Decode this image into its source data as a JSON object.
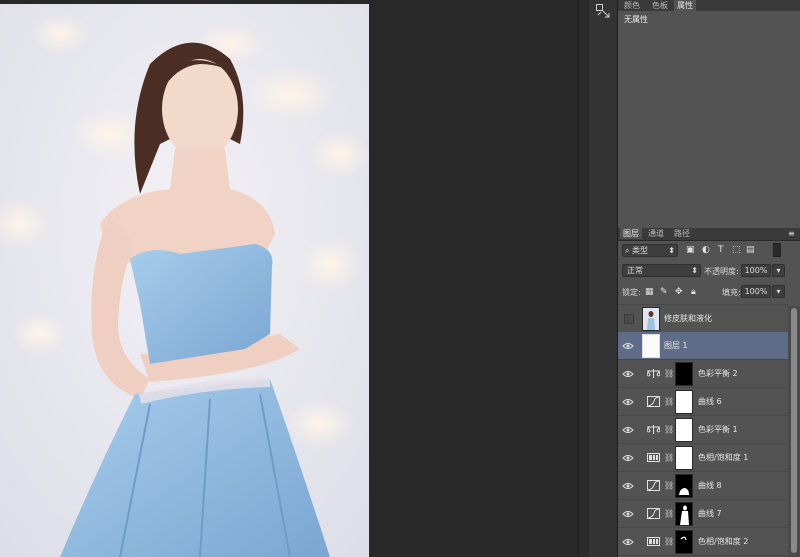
{
  "top_panel": {
    "tabs": [
      "颜色",
      "色板",
      "属性"
    ],
    "active_tab": "属性",
    "message": "无属性"
  },
  "layers_panel": {
    "tabs": [
      "图层",
      "通道",
      "路径"
    ],
    "active_tab": "图层",
    "filter_label": "类型",
    "blend_mode": "正常",
    "opacity_label": "不透明度:",
    "opacity_value": "100%",
    "lock_label": "锁定:",
    "fill_label": "填充:",
    "fill_value": "100%",
    "layers": [
      {
        "name": "修皮肤和液化",
        "visible": false,
        "selected": false,
        "type": "pixel",
        "icon": "photo-thumbnail"
      },
      {
        "name": "图层 1",
        "visible": true,
        "selected": true,
        "type": "pixel",
        "icon": "white-thumbnail"
      },
      {
        "name": "色彩平衡 2",
        "visible": true,
        "selected": false,
        "type": "adjustment",
        "icon": "balance-icon",
        "mask": "black"
      },
      {
        "name": "曲线 6",
        "visible": true,
        "selected": false,
        "type": "adjustment",
        "icon": "curves-icon",
        "mask": "white"
      },
      {
        "name": "色彩平衡 1",
        "visible": true,
        "selected": false,
        "type": "adjustment",
        "icon": "balance-icon",
        "mask": "white"
      },
      {
        "name": "色相/饱和度 1",
        "visible": true,
        "selected": false,
        "type": "adjustment",
        "icon": "hue-saturation-icon",
        "mask": "white"
      },
      {
        "name": "曲线 8",
        "visible": true,
        "selected": false,
        "type": "adjustment",
        "icon": "curves-icon",
        "mask": "black-with-shape"
      },
      {
        "name": "曲线 7",
        "visible": true,
        "selected": false,
        "type": "adjustment",
        "icon": "curves-icon",
        "mask": "black-with-figure"
      },
      {
        "name": "色相/饱和度 2",
        "visible": true,
        "selected": false,
        "type": "adjustment",
        "icon": "hue-saturation-icon",
        "mask": "black-with-stroke"
      }
    ]
  },
  "colors": {
    "canvas_bg": "#282828",
    "panel_bg": "#535353",
    "selected_row": "#5f6c87",
    "dress": "#8fb8de"
  }
}
